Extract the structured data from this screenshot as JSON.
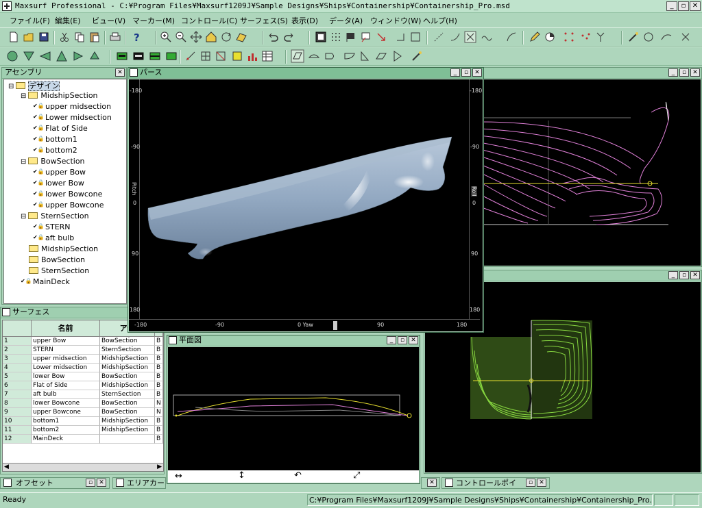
{
  "app": {
    "title": "Maxsurf Professional - C:¥Program Files¥Maxsurf1209J¥Sample Designs¥Ships¥Containership¥Containership_Pro.msd",
    "window_buttons": [
      "_",
      "▫",
      "✕"
    ]
  },
  "menu": [
    "ファイル(F)",
    "編集(E)",
    "ビュー(V)",
    "マーカー(M)",
    "コントロール(C)",
    "サーフェス(S)",
    "表示(D)",
    "データ(A)",
    "ウィンドウ(W)",
    "ヘルプ(H)"
  ],
  "assembly": {
    "title": "アセンブリ",
    "tree": [
      {
        "label": "デザイン",
        "level": 0,
        "type": "folder",
        "selected": true
      },
      {
        "label": "MidshipSection",
        "level": 1,
        "type": "folder"
      },
      {
        "label": "upper midsection",
        "level": 2,
        "type": "surface"
      },
      {
        "label": "Lower midsection",
        "level": 2,
        "type": "surface"
      },
      {
        "label": "Flat of Side",
        "level": 2,
        "type": "surface"
      },
      {
        "label": "bottom1",
        "level": 2,
        "type": "surface"
      },
      {
        "label": "bottom2",
        "level": 2,
        "type": "surface"
      },
      {
        "label": "BowSection",
        "level": 1,
        "type": "folder"
      },
      {
        "label": "upper Bow",
        "level": 2,
        "type": "surface"
      },
      {
        "label": "lower Bow",
        "level": 2,
        "type": "surface"
      },
      {
        "label": "lower Bowcone",
        "level": 2,
        "type": "surface"
      },
      {
        "label": "upper Bowcone",
        "level": 2,
        "type": "surface"
      },
      {
        "label": "SternSection",
        "level": 1,
        "type": "folder"
      },
      {
        "label": "STERN",
        "level": 2,
        "type": "surface"
      },
      {
        "label": "aft bulb",
        "level": 2,
        "type": "surface"
      },
      {
        "label": "MidshipSection",
        "level": 1,
        "type": "folder-closed"
      },
      {
        "label": "BowSection",
        "level": 1,
        "type": "folder-closed"
      },
      {
        "label": "SternSection",
        "level": 1,
        "type": "folder-closed"
      },
      {
        "label": "MainDeck",
        "level": 1,
        "type": "surface"
      }
    ]
  },
  "surfaces": {
    "title": "サーフェス",
    "headers": [
      "名前",
      "アセ",
      ""
    ],
    "rows": [
      {
        "no": "1",
        "name": "upper Bow",
        "assembly": "BowSection",
        "x": "B"
      },
      {
        "no": "2",
        "name": "STERN",
        "assembly": "SternSection",
        "x": "B"
      },
      {
        "no": "3",
        "name": "upper midsection",
        "assembly": "MidshipSection",
        "x": "B"
      },
      {
        "no": "4",
        "name": "Lower midsection",
        "assembly": "MidshipSection",
        "x": "B"
      },
      {
        "no": "5",
        "name": "lower Bow",
        "assembly": "BowSection",
        "x": "B"
      },
      {
        "no": "6",
        "name": "Flat of Side",
        "assembly": "MidshipSection",
        "x": "B"
      },
      {
        "no": "7",
        "name": "aft bulb",
        "assembly": "SternSection",
        "x": "B"
      },
      {
        "no": "8",
        "name": "lower Bowcone",
        "assembly": "BowSection",
        "x": "N"
      },
      {
        "no": "9",
        "name": "upper Bowcone",
        "assembly": "BowSection",
        "x": "N"
      },
      {
        "no": "10",
        "name": "bottom1",
        "assembly": "MidshipSection",
        "x": "B"
      },
      {
        "no": "11",
        "name": "bottom2",
        "assembly": "MidshipSection",
        "x": "B"
      },
      {
        "no": "12",
        "name": "MainDeck",
        "assembly": "",
        "x": "B"
      }
    ]
  },
  "perspective": {
    "title": "パース",
    "left_ticks": [
      "-180",
      "-90",
      "0",
      "90",
      "180"
    ],
    "left_label": "Pitch",
    "right_ticks": [
      "-180",
      "-90",
      "0",
      "90",
      "180"
    ],
    "right_label": "Roll",
    "bottom_ticks": [
      "-180",
      "-90",
      "0 Yaw",
      "90",
      "180"
    ]
  },
  "plan": {
    "title": "平面図"
  },
  "minimized": {
    "offset": "オフセット",
    "area": "エリアカーブ",
    "control": "コントロールポイ"
  },
  "status": {
    "ready": "Ready",
    "path": "C:¥Program Files¥Maxsurf1209J¥Sample Designs¥Ships¥Containership¥Containership_Pro.msd*"
  },
  "colors": {
    "background": "#aed6bc",
    "hull": "#93a9c2",
    "profile_lines": "#e080d8",
    "yellow": "#e8e030",
    "body_plan": "#88d840"
  }
}
